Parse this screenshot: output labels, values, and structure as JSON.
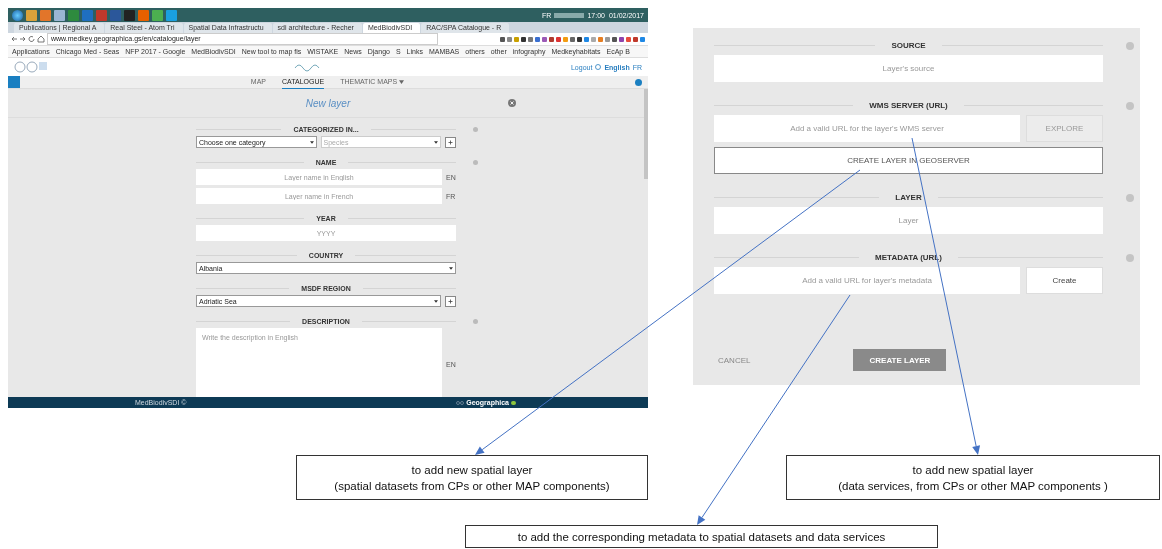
{
  "taskbar": {
    "language": "FR",
    "time": "17:00",
    "date": "01/02/2017"
  },
  "browser": {
    "tabs": [
      {
        "title": "Publications | Regional A",
        "selected": false
      },
      {
        "title": "Real Steel - Atom Tri",
        "selected": false
      },
      {
        "title": "Spatial Data Infrastructu",
        "selected": false
      },
      {
        "title": "sdi architecture - Recher",
        "selected": false
      },
      {
        "title": "MedBiodivSDI",
        "selected": true
      },
      {
        "title": "RAC/SPA Catalogue - R",
        "selected": false
      }
    ],
    "address": "www.medkey.geographica.gs/en/catalogue/layer",
    "bookmarks": [
      "Applications",
      "Chicago Med - Seas",
      "NFP 2017 - Google",
      "MedBiodivSDI",
      "New tool to map fis",
      "WISTAKE",
      "News",
      "Django",
      "S",
      "Links",
      "MAMBAS",
      "others",
      "other",
      "infography",
      "Medkeyhabitats",
      "EcAp B"
    ]
  },
  "site": {
    "header": {
      "logout": "Logout",
      "language": "English",
      "alt_language": "FR"
    },
    "nav": [
      {
        "label": "MAP",
        "selected": false,
        "dropdown": false
      },
      {
        "label": "CATALOGUE",
        "selected": true,
        "dropdown": false
      },
      {
        "label": "THEMATIC MAPS",
        "selected": false,
        "dropdown": true
      }
    ],
    "title": "New layer",
    "sections": [
      {
        "label": "CATEGORIZED IN...",
        "info": true,
        "rows": [
          [
            {
              "kind": "select",
              "value": "Choose one category",
              "disabled": false
            },
            {
              "kind": "select",
              "value": "Species",
              "disabled": true
            },
            {
              "kind": "add"
            }
          ]
        ]
      },
      {
        "label": "NAME",
        "info": true,
        "rows": [
          [
            {
              "kind": "input",
              "placeholder": "Layer name in English"
            },
            {
              "kind": "lang",
              "text": "EN"
            }
          ],
          [
            {
              "kind": "input",
              "placeholder": "Layer name in French"
            },
            {
              "kind": "lang",
              "text": "FR"
            }
          ]
        ]
      },
      {
        "label": "YEAR",
        "info": false,
        "rows": [
          [
            {
              "kind": "input",
              "placeholder": "YYYY"
            }
          ]
        ]
      },
      {
        "label": "COUNTRY",
        "info": false,
        "rows": [
          [
            {
              "kind": "select",
              "value": "Albania",
              "disabled": false
            }
          ]
        ]
      },
      {
        "label": "MSDF REGION",
        "info": false,
        "rows": [
          [
            {
              "kind": "select",
              "value": "Adriatic Sea",
              "disabled": false
            },
            {
              "kind": "add"
            }
          ]
        ]
      },
      {
        "label": "DESCRIPTION",
        "info": true,
        "rows": [
          [
            {
              "kind": "textarea",
              "placeholder": "Write the description in English"
            },
            {
              "kind": "lang",
              "text": "EN"
            }
          ]
        ]
      }
    ],
    "footer": {
      "copyright": "MedBiodivSDI ©",
      "brand": "Geographica"
    }
  },
  "layer_form": {
    "sections": [
      {
        "label": "SOURCE",
        "info": true,
        "rows": [
          [
            {
              "kind": "input",
              "placeholder": "Layer's source"
            }
          ]
        ]
      },
      {
        "label": "WMS SERVER (URL)",
        "info": true,
        "rows": [
          [
            {
              "kind": "input",
              "placeholder": "Add a valid URL for the layer's WMS server"
            },
            {
              "kind": "button",
              "label": "EXPLORE",
              "disabled": true
            }
          ],
          [
            {
              "kind": "block-button",
              "label": "CREATE LAYER IN GEOSERVER",
              "disabled": false
            }
          ]
        ]
      },
      {
        "label": "LAYER",
        "info": true,
        "rows": [
          [
            {
              "kind": "input",
              "placeholder": "Layer"
            }
          ]
        ]
      },
      {
        "label": "METADATA (URL)",
        "info": true,
        "rows": [
          [
            {
              "kind": "input",
              "placeholder": "Add a valid URL for layer's metadata"
            },
            {
              "kind": "button",
              "label": "Create",
              "disabled": false
            }
          ]
        ]
      }
    ],
    "cancel": "CANCEL",
    "submit": "CREATE LAYER"
  },
  "callouts": [
    {
      "lines": [
        "to add new spatial layer",
        "(spatial datasets from CPs or other MAP components)"
      ]
    },
    {
      "lines": [
        "to add new spatial layer",
        "(data services, from CPs or other MAP components )"
      ]
    },
    {
      "lines": [
        "to add the corresponding metadata to spatial datasets and data services"
      ]
    }
  ]
}
